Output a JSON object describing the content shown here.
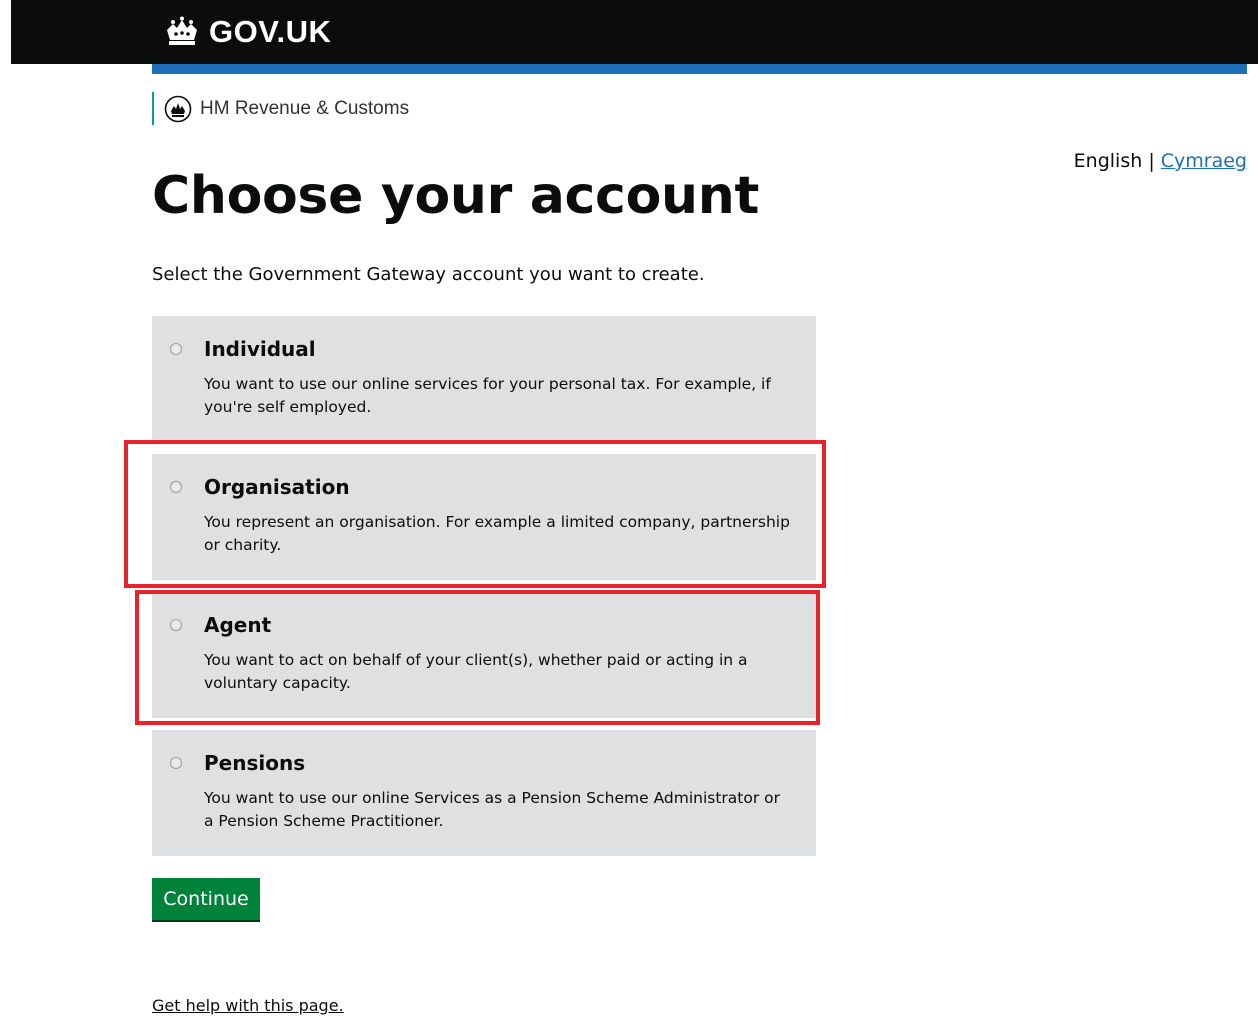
{
  "header": {
    "logo_text": "GOV.UK",
    "department": "HM Revenue & Customs"
  },
  "language": {
    "current": "English",
    "separator": "|",
    "alternate": "Cymraeg"
  },
  "page": {
    "title": "Choose your account",
    "lede": "Select the Government Gateway account you want to create."
  },
  "options": [
    {
      "label": "Individual",
      "hint": "You want to use our online services for your personal tax. For example, if you're self employed."
    },
    {
      "label": "Organisation",
      "hint": "You represent an organisation. For example a limited company, partnership or charity."
    },
    {
      "label": "Agent",
      "hint": "You want to act on behalf of your client(s), whether paid or acting in a voluntary capacity."
    },
    {
      "label": "Pensions",
      "hint": "You want to use our online Services as a Pension Scheme Administrator or a Pension Scheme Practitioner."
    }
  ],
  "actions": {
    "continue_label": "Continue"
  },
  "footer": {
    "help_link": "Get help with this page."
  },
  "colors": {
    "header_bg": "#0b0c0c",
    "accent_blue": "#1d70b8",
    "option_bg": "#dee0e2",
    "button_green": "#00823b",
    "highlight_red": "#e8232c"
  }
}
